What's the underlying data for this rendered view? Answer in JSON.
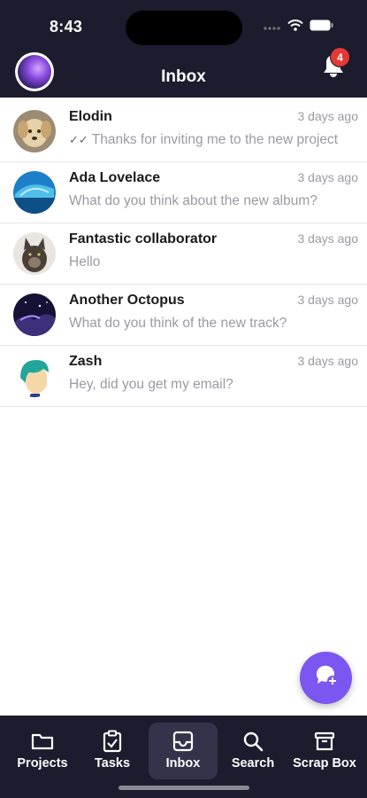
{
  "status_bar": {
    "time": "8:43"
  },
  "header": {
    "title": "Inbox",
    "notification_count": "4"
  },
  "conversations": [
    {
      "name": "Elodin",
      "time": "3 days ago",
      "preview": "Thanks for inviting me to the new project",
      "read_receipt": "✓✓"
    },
    {
      "name": "Ada Lovelace",
      "time": "3 days ago",
      "preview": "What do you think about the new album?"
    },
    {
      "name": "Fantastic collaborator",
      "time": "3 days ago",
      "preview": "Hello"
    },
    {
      "name": "Another Octopus",
      "time": "3 days ago",
      "preview": "What do you think of the new track?"
    },
    {
      "name": "Zash",
      "time": "3 days ago",
      "preview": "Hey, did you get my email?"
    }
  ],
  "tabs": [
    {
      "label": "Projects",
      "icon": "folder-icon"
    },
    {
      "label": "Tasks",
      "icon": "clipboard-check-icon"
    },
    {
      "label": "Inbox",
      "icon": "inbox-icon"
    },
    {
      "label": "Search",
      "icon": "search-icon"
    },
    {
      "label": "Scrap Box",
      "icon": "archive-box-icon"
    }
  ],
  "colors": {
    "header_bg": "#1d1c2e",
    "accent": "#7c56f0",
    "badge": "#e53935",
    "muted_text": "#9a9aa2"
  }
}
